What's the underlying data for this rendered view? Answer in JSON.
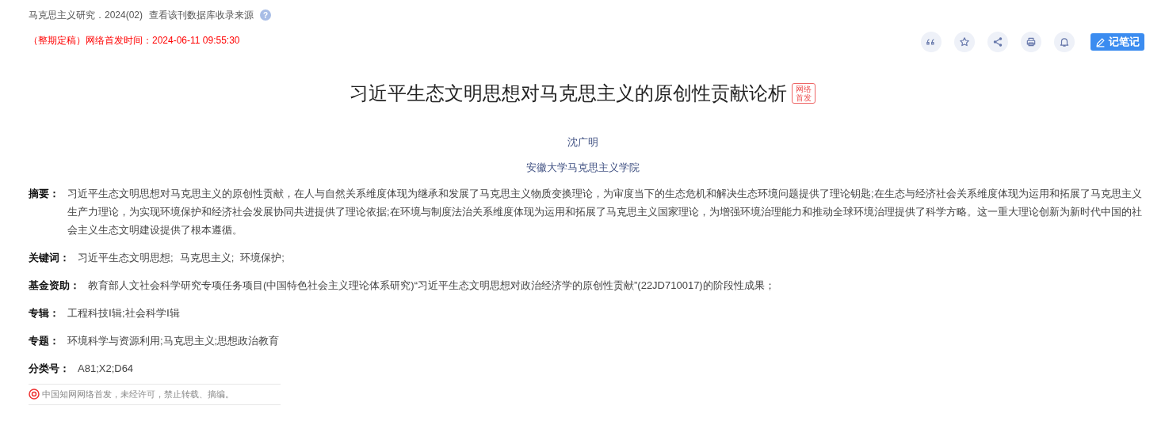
{
  "source": {
    "journal": "马克思主义研究．2024(02)",
    "link": "查看该刊数据库收录来源",
    "help": "?"
  },
  "publish_note": "（整期定稿）网络首发时间：2024-06-11 09:55:30",
  "note_button": "记笔记",
  "title": "习近平生态文明思想对马克思主义的原创性贡献论析",
  "title_badge": "网络首发",
  "author": "沈广明",
  "affiliation": "安徽大学马克思主义学院",
  "fields": [
    {
      "kind": "text",
      "label": "摘要：",
      "value": "习近平生态文明思想对马克思主义的原创性贡献，在人与自然关系维度体现为继承和发展了马克思主义物质变换理论，为审度当下的生态危机和解决生态环境问题提供了理论钥匙;在生态与经济社会关系维度体现为运用和拓展了马克思主义生产力理论，为实现环境保护和经济社会发展协同共进提供了理论依据;在环境与制度法治关系维度体现为运用和拓展了马克思主义国家理论，为增强环境治理能力和推动全球环境治理提供了科学方略。这一重大理论创新为新时代中国的社会主义生态文明建设提供了根本遵循。"
    },
    {
      "kind": "links",
      "label": "关键词：",
      "items": [
        "习近平生态文明思想;",
        "马克思主义;",
        "环境保护;"
      ]
    },
    {
      "kind": "text",
      "label": "基金资助：",
      "value": "教育部人文社会科学研究专项任务项目(中国特色社会主义理论体系研究)“习近平生态文明思想对政治经济学的原创性贡献”(22JD710017)的阶段性成果；"
    },
    {
      "kind": "text",
      "label": "专辑：",
      "value": "工程科技Ⅰ辑;社会科学Ⅰ辑"
    },
    {
      "kind": "text",
      "label": "专题：",
      "value": "环境科学与资源利用;马克思主义;思想政治教育"
    },
    {
      "kind": "text",
      "label": "分类号：",
      "value": "A81;X2;D64"
    }
  ],
  "copyright": "中国知网网络首发，未经许可，禁止转载、摘编。"
}
